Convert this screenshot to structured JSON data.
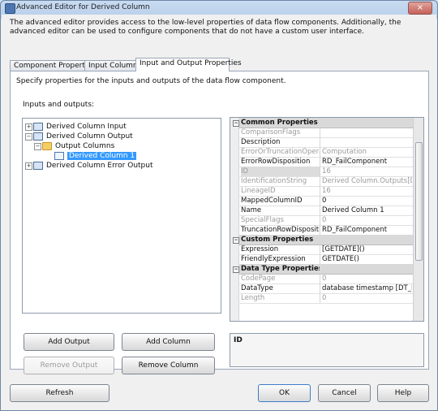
{
  "window": {
    "title": "Advanced Editor for Derived Column",
    "close_glyph": "×"
  },
  "description": "The advanced editor provides access to the low-level properties of data flow components. Additionally, the advanced editor can be used to configure components that do not have a custom user interface.",
  "tabs": [
    {
      "label": "Component Properties",
      "active": false
    },
    {
      "label": "Input Columns",
      "active": false
    },
    {
      "label": "Input and Output Properties",
      "active": true
    }
  ],
  "panel": {
    "description": "Specify properties for the inputs and outputs of the data flow component.",
    "inputs_outputs_label": "Inputs and outputs:"
  },
  "tree": [
    {
      "label": "Derived Column Input",
      "expander": "+",
      "icon": "input-node-icon",
      "level": 0
    },
    {
      "label": "Derived Column Output",
      "expander": "−",
      "icon": "output-node-icon",
      "level": 0
    },
    {
      "label": "Output Columns",
      "expander": "−",
      "icon": "folder-icon",
      "level": 1
    },
    {
      "label": "Derived Column 1",
      "expander": "",
      "icon": "column-icon",
      "level": 2,
      "selected": true
    },
    {
      "label": "Derived Column Error Output",
      "expander": "+",
      "icon": "error-output-node-icon",
      "level": 0
    }
  ],
  "buttons": {
    "add_output": "Add Output",
    "add_column": "Add Column",
    "remove_output": "Remove Output",
    "remove_column": "Remove Column"
  },
  "property_grid": {
    "categories": [
      {
        "title": "Common Properties",
        "rows": [
          {
            "name": "ComparisonFlags",
            "value": "",
            "gray": true
          },
          {
            "name": "Description",
            "value": "",
            "gray": false
          },
          {
            "name": "ErrorOrTruncationOperation",
            "value": "Computation",
            "gray": true
          },
          {
            "name": "ErrorRowDisposition",
            "value": "RD_FailComponent",
            "gray": false
          },
          {
            "name": "ID",
            "value": "16",
            "gray": true,
            "highlight": true
          },
          {
            "name": "IdentificationString",
            "value": "Derived Column.Outputs[Derived",
            "gray": true
          },
          {
            "name": "LineageID",
            "value": "16",
            "gray": true
          },
          {
            "name": "MappedColumnID",
            "value": "0",
            "gray": false
          },
          {
            "name": "Name",
            "value": "Derived Column 1",
            "gray": false
          },
          {
            "name": "SpecialFlags",
            "value": "0",
            "gray": true
          },
          {
            "name": "TruncationRowDisposition",
            "value": "RD_FailComponent",
            "gray": false
          }
        ]
      },
      {
        "title": "Custom Properties",
        "rows": [
          {
            "name": "Expression",
            "value": "[GETDATE]()",
            "gray": false
          },
          {
            "name": "FriendlyExpression",
            "value": "GETDATE()",
            "gray": false
          }
        ]
      },
      {
        "title": "Data Type Properties",
        "rows": [
          {
            "name": "CodePage",
            "value": "0",
            "gray": true
          },
          {
            "name": "DataType",
            "value": "database timestamp [DT_DBTIM",
            "gray": false
          },
          {
            "name": "Length",
            "value": "0",
            "gray": true
          }
        ]
      }
    ],
    "description_title": "ID"
  },
  "footer_buttons": {
    "refresh": "Refresh",
    "ok": "OK",
    "cancel": "Cancel",
    "help": "Help"
  }
}
